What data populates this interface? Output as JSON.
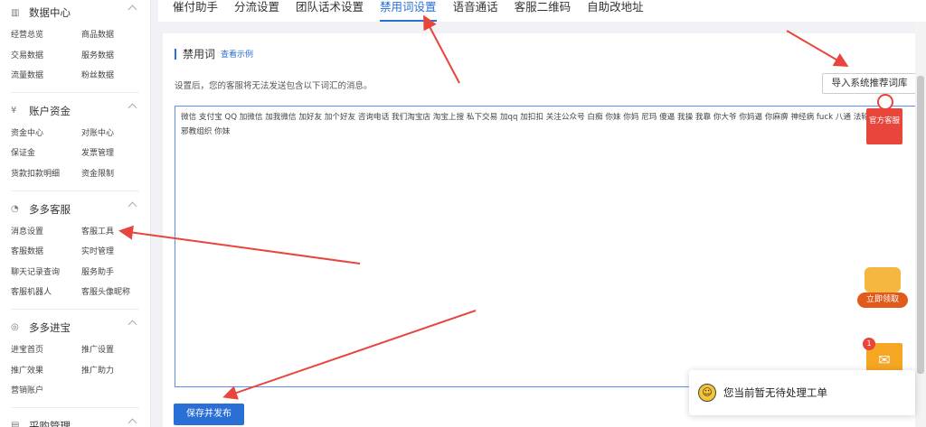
{
  "sidebar": {
    "sections": [
      {
        "title": "数据中心",
        "icon": "chart-icon",
        "items": [
          "经营总览",
          "商品数据",
          "交易数据",
          "服务数据",
          "流量数据",
          "粉丝数据"
        ]
      },
      {
        "title": "账户资金",
        "icon": "yen-icon",
        "items": [
          "资金中心",
          "对账中心",
          "保证金",
          "发票管理",
          "货款扣款明细",
          "资金限制"
        ]
      },
      {
        "title": "多多客服",
        "icon": "headset-icon",
        "items": [
          "消息设置",
          "客服工具",
          "客服数据",
          "实时管理",
          "聊天记录查询",
          "服务助手",
          "客服机器人",
          "客服头像昵称"
        ]
      },
      {
        "title": "多多进宝",
        "icon": "promo-icon",
        "items": [
          "进宝首页",
          "推广设置",
          "推广效果",
          "推广助力",
          "营销账户"
        ]
      },
      {
        "title": "采购管理",
        "icon": "purchase-icon",
        "items": []
      }
    ]
  },
  "tabs": [
    {
      "label": "催付助手",
      "active": false
    },
    {
      "label": "分流设置",
      "active": false
    },
    {
      "label": "团队话术设置",
      "active": false
    },
    {
      "label": "禁用词设置",
      "active": true
    },
    {
      "label": "语音通话",
      "active": false
    },
    {
      "label": "客服二维码",
      "active": false
    },
    {
      "label": "自助改地址",
      "active": false
    }
  ],
  "panel": {
    "title": "禁用词",
    "example_link": "查看示例",
    "description": "设置后，您的客服将无法发送包含以下词汇的消息。",
    "import_button": "导入系统推荐词库",
    "textarea_value": "微信 支付宝 QQ 加微信 加我微信 加好友 加个好友 咨询电话 我们淘宝店 淘宝上搜 私下交易 加qq 加扣扣 关注公众号 白痴 你妹 你妈 尼玛 傻逼 我操 我靠 你大爷 你妈逼 你麻痹 神经病 fuck 八通 法轮功 全能神 邪教组织 你妹",
    "save_button": "保存并发布"
  },
  "floating": {
    "service_label": "官方客服",
    "promo_label": "立即领取",
    "mail_badge": "1",
    "mail_icon": "mail-icon"
  },
  "toast": {
    "message": "您当前暂无待处理工单"
  },
  "colors": {
    "accent": "#2a6fd6",
    "arrow": "#e8453c"
  }
}
